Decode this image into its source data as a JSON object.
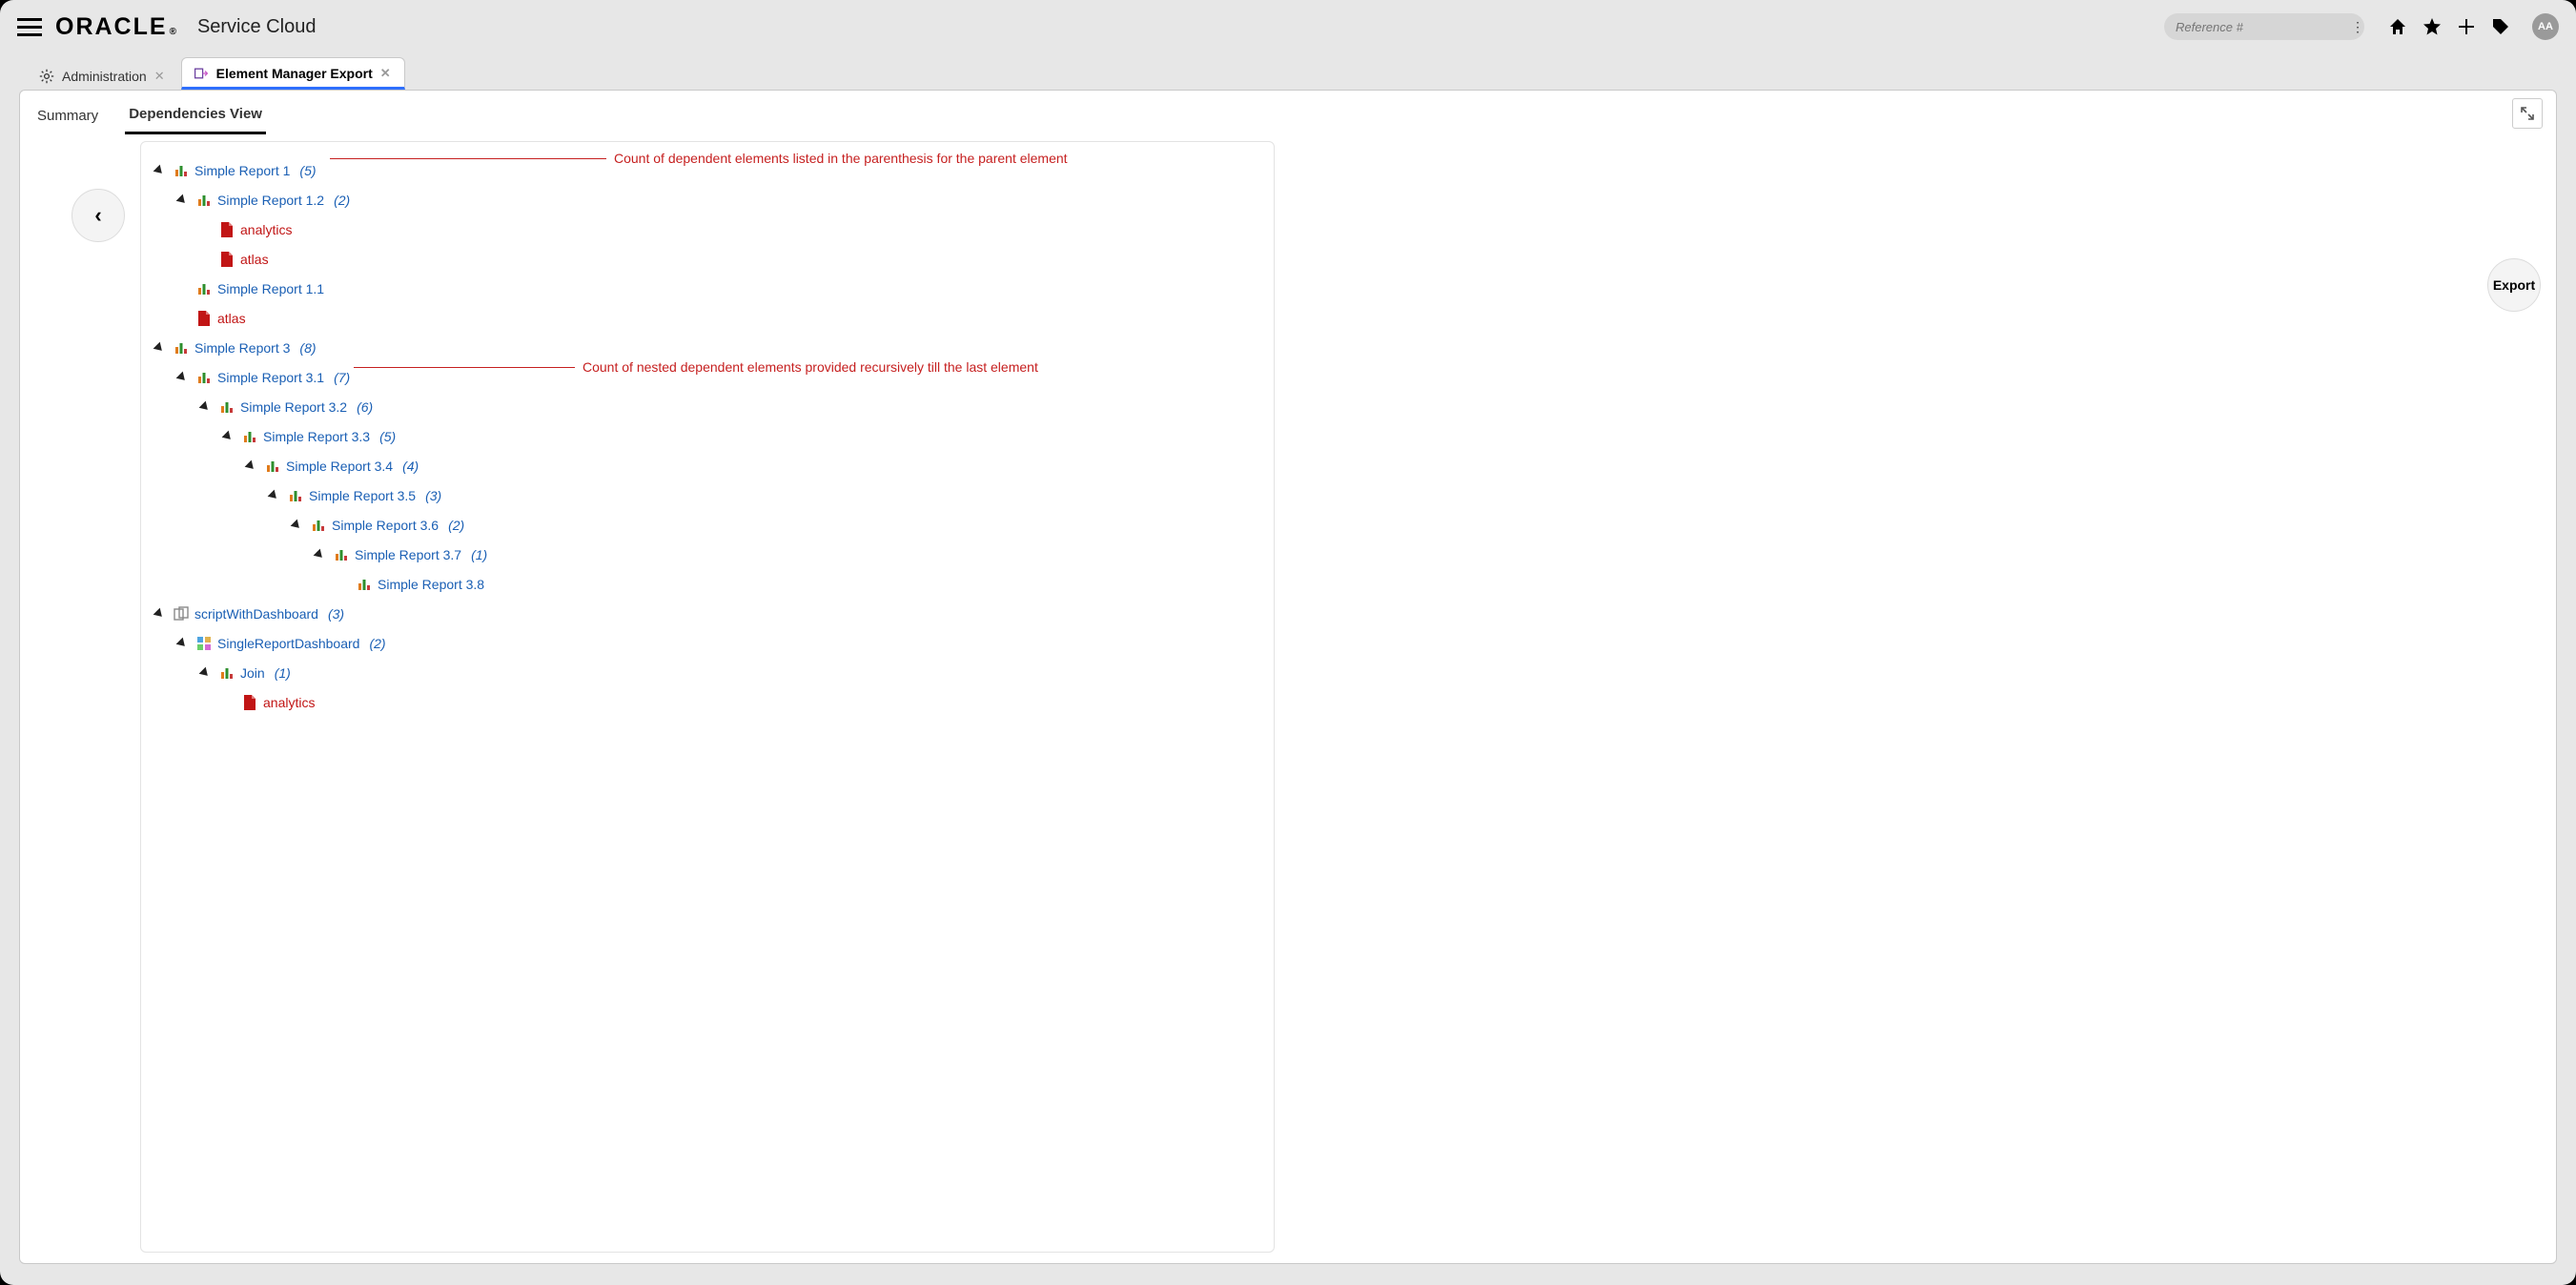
{
  "branding": {
    "logo": "ORACLE",
    "product": "Service Cloud"
  },
  "search": {
    "placeholder": "Reference #"
  },
  "avatar": {
    "initials": "AA"
  },
  "app_tabs": [
    {
      "label": "Administration",
      "active": false
    },
    {
      "label": "Element Manager Export",
      "active": true
    }
  ],
  "sub_tabs": [
    {
      "label": "Summary",
      "active": false
    },
    {
      "label": "Dependencies View",
      "active": true
    }
  ],
  "nav": {
    "back_glyph": "‹",
    "export_label": "Export"
  },
  "annotations": {
    "a0": "Count of dependent elements listed in the parenthesis for the parent element",
    "a1": "Count of nested dependent elements provided recursively till the last element"
  },
  "tree": [
    {
      "indent": 0,
      "twisty": true,
      "icon": "report",
      "name": "Simple Report 1",
      "count": 5
    },
    {
      "indent": 1,
      "twisty": true,
      "icon": "report",
      "name": "Simple Report 1.2",
      "count": 2
    },
    {
      "indent": 2,
      "twisty": false,
      "icon": "file",
      "name": "analytics",
      "file": true
    },
    {
      "indent": 2,
      "twisty": false,
      "icon": "file",
      "name": "atlas",
      "file": true
    },
    {
      "indent": 1,
      "twisty": false,
      "icon": "report",
      "name": "Simple Report 1.1"
    },
    {
      "indent": 1,
      "twisty": false,
      "icon": "file",
      "name": "atlas",
      "file": true
    },
    {
      "indent": 0,
      "twisty": true,
      "icon": "report",
      "name": "Simple Report 3",
      "count": 8
    },
    {
      "indent": 1,
      "twisty": true,
      "icon": "report",
      "name": "Simple Report 3.1",
      "count": 7
    },
    {
      "indent": 2,
      "twisty": true,
      "icon": "report",
      "name": "Simple Report 3.2",
      "count": 6
    },
    {
      "indent": 3,
      "twisty": true,
      "icon": "report",
      "name": "Simple Report 3.3",
      "count": 5
    },
    {
      "indent": 4,
      "twisty": true,
      "icon": "report",
      "name": "Simple Report 3.4",
      "count": 4
    },
    {
      "indent": 5,
      "twisty": true,
      "icon": "report",
      "name": "Simple Report 3.5",
      "count": 3
    },
    {
      "indent": 6,
      "twisty": true,
      "icon": "report",
      "name": "Simple Report 3.6",
      "count": 2
    },
    {
      "indent": 7,
      "twisty": true,
      "icon": "report",
      "name": "Simple Report 3.7",
      "count": 1
    },
    {
      "indent": 8,
      "twisty": false,
      "icon": "report",
      "name": "Simple Report 3.8"
    },
    {
      "indent": 0,
      "twisty": true,
      "icon": "script",
      "name": "scriptWithDashboard",
      "count": 3
    },
    {
      "indent": 1,
      "twisty": true,
      "icon": "dashboard",
      "name": "SingleReportDashboard",
      "count": 2
    },
    {
      "indent": 2,
      "twisty": true,
      "icon": "report",
      "name": "Join",
      "count": 1
    },
    {
      "indent": 3,
      "twisty": false,
      "icon": "file",
      "name": "analytics",
      "file": true
    }
  ]
}
